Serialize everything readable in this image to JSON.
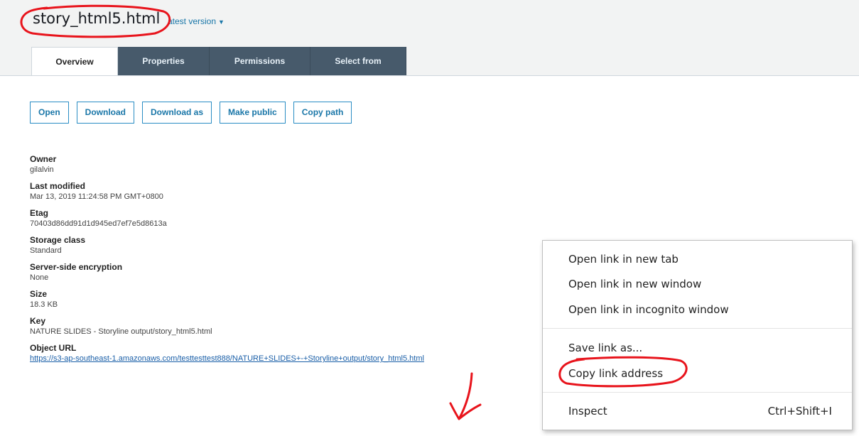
{
  "header": {
    "title": "story_html5.html",
    "version_label": "atest version",
    "version_caret": "▼"
  },
  "tabs": [
    {
      "label": "Overview"
    },
    {
      "label": "Properties"
    },
    {
      "label": "Permissions"
    },
    {
      "label": "Select from"
    }
  ],
  "actions": {
    "open": "Open",
    "download": "Download",
    "download_as": "Download as",
    "make_public": "Make public",
    "copy_path": "Copy path"
  },
  "properties": {
    "owner": {
      "label": "Owner",
      "value": "gilalvin"
    },
    "last_modified": {
      "label": "Last modified",
      "value": "Mar 13, 2019 11:24:58 PM GMT+0800"
    },
    "etag": {
      "label": "Etag",
      "value": "70403d86dd91d1d945ed7ef7e5d8613a"
    },
    "storage_class": {
      "label": "Storage class",
      "value": "Standard"
    },
    "encryption": {
      "label": "Server-side encryption",
      "value": "None"
    },
    "size": {
      "label": "Size",
      "value": "18.3 KB"
    },
    "key": {
      "label": "Key",
      "value": "NATURE SLIDES - Storyline output/story_html5.html"
    },
    "object_url": {
      "label": "Object URL",
      "value": "https://s3-ap-southeast-1.amazonaws.com/testtesttest888/NATURE+SLIDES+-+Storyline+output/story_html5.html"
    }
  },
  "context_menu": {
    "items": [
      {
        "label": "Open link in new tab"
      },
      {
        "label": "Open link in new window"
      },
      {
        "label": "Open link in incognito window"
      },
      {
        "label": "Save link as..."
      },
      {
        "label": "Copy link address"
      },
      {
        "label": "Inspect",
        "shortcut": "Ctrl+Shift+I"
      }
    ]
  },
  "colors": {
    "annotation": "#e8141c",
    "tab_dark": "#475a6b",
    "button_border": "#2a8dc4"
  }
}
